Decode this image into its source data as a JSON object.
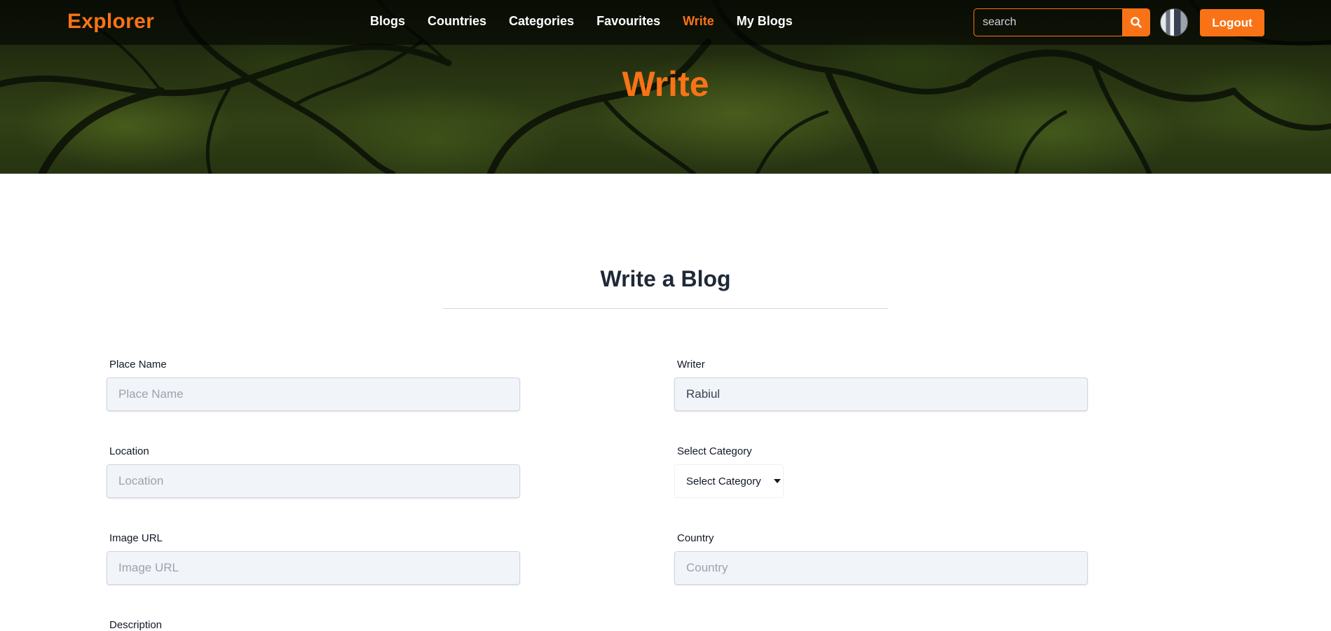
{
  "nav": {
    "logo": "Explorer",
    "links": [
      {
        "label": "Blogs",
        "active": false
      },
      {
        "label": "Countries",
        "active": false
      },
      {
        "label": "Categories",
        "active": false
      },
      {
        "label": "Favourites",
        "active": false
      },
      {
        "label": "Write",
        "active": true
      },
      {
        "label": "My Blogs",
        "active": false
      }
    ],
    "search_placeholder": "search",
    "search_icon": "search-icon",
    "logout_label": "Logout"
  },
  "hero": {
    "title": "Write"
  },
  "form": {
    "heading": "Write a Blog",
    "fields": {
      "place_name": {
        "label": "Place Name",
        "placeholder": "Place Name",
        "value": ""
      },
      "writer": {
        "label": "Writer",
        "placeholder": "",
        "value": "Rabiul"
      },
      "location": {
        "label": "Location",
        "placeholder": "Location",
        "value": ""
      },
      "category": {
        "label": "Select Category",
        "selected": "Select Category"
      },
      "image_url": {
        "label": "Image URL",
        "placeholder": "Image URL",
        "value": ""
      },
      "country": {
        "label": "Country",
        "placeholder": "Country",
        "value": ""
      },
      "next_label": "Description"
    }
  },
  "colors": {
    "accent": "#f97316",
    "field_bg": "#f1f4f9",
    "heading": "#1f2937"
  }
}
